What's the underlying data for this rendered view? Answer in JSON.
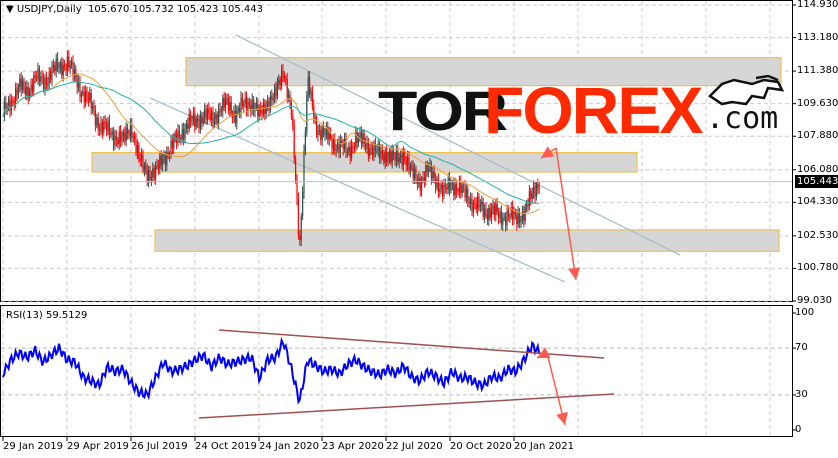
{
  "header": {
    "symbol": "USDJPY,Daily",
    "open": "105.670",
    "high": "105.732",
    "low": "105.423",
    "close": "105.443"
  },
  "logo": {
    "tor": "TOR",
    "forex": "FOREX",
    "com": ".com"
  },
  "rsi_label": "RSI(13) 59.5129",
  "current_price": "105.443",
  "chart_data": {
    "type": "line",
    "title": "USDJPY,Daily",
    "price_axis": {
      "ticks": [
        "114.930",
        "113.180",
        "111.380",
        "109.630",
        "107.880",
        "106.080",
        "104.330",
        "102.530",
        "100.780",
        "99.030"
      ],
      "ylim": [
        99.03,
        114.93
      ]
    },
    "rsi_axis": {
      "ticks": [
        "100",
        "70",
        "30",
        "0"
      ],
      "ylim": [
        0,
        100
      ]
    },
    "x_ticks": [
      "29 Jan 2019",
      "29 Apr 2019",
      "26 Jul 2019",
      "24 Oct 2019",
      "24 Jan 2020",
      "23 Apr 2020",
      "22 Jul 2020",
      "20 Oct 2020",
      "20 Jan 2021"
    ],
    "close": [
      109.0,
      109.8,
      110.5,
      110.3,
      111.0,
      110.8,
      111.3,
      111.6,
      111.9,
      111.0,
      110.2,
      109.5,
      108.5,
      108.2,
      107.9,
      107.6,
      108.5,
      106.5,
      106.0,
      105.8,
      106.8,
      107.2,
      108.0,
      108.5,
      108.7,
      109.0,
      108.8,
      109.3,
      109.6,
      109.1,
      109.5,
      109.8,
      108.9,
      109.8,
      110.0,
      111.6,
      109.0,
      102.0,
      110.8,
      108.5,
      108.0,
      107.6,
      107.4,
      107.0,
      107.8,
      107.5,
      107.3,
      106.8,
      107.0,
      106.5,
      107.0,
      105.8,
      105.5,
      106.0,
      105.6,
      104.8,
      105.4,
      105.0,
      104.6,
      104.2,
      103.8,
      104.0,
      103.4,
      103.8,
      103.3,
      103.9,
      104.6,
      105.6
    ],
    "rsi": [
      48,
      60,
      66,
      62,
      68,
      58,
      64,
      70,
      60,
      58,
      45,
      42,
      38,
      54,
      50,
      52,
      40,
      32,
      30,
      44,
      58,
      50,
      52,
      55,
      60,
      64,
      54,
      62,
      56,
      58,
      60,
      62,
      44,
      60,
      62,
      76,
      52,
      24,
      60,
      55,
      50,
      52,
      48,
      56,
      60,
      54,
      50,
      47,
      52,
      48,
      55,
      45,
      42,
      50,
      46,
      40,
      50,
      44,
      45,
      40,
      38,
      46,
      44,
      52,
      50,
      60,
      72,
      66
    ],
    "zones": [
      {
        "from": 110.6,
        "to": 112.1
      },
      {
        "from": 105.96,
        "to": 107.0
      },
      {
        "from": 101.7,
        "to": 102.85
      }
    ],
    "colors": {
      "bull": "#2f4f4f",
      "bear": "#ff0000",
      "ma_fast": "#e8a33a",
      "ma_slow": "#20b2aa",
      "rsi": "#0000ff",
      "arrow": "#ff5a4e"
    }
  }
}
